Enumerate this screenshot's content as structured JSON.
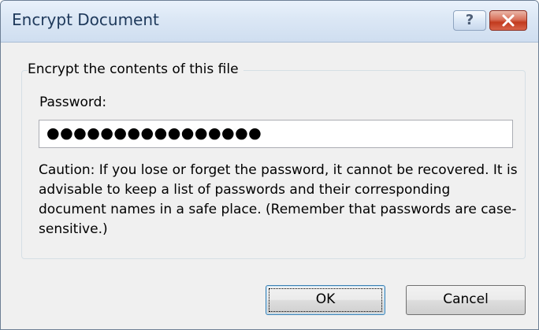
{
  "window": {
    "title": "Encrypt Document",
    "help_glyph": "?",
    "close_icon": "close-icon"
  },
  "group": {
    "legend": "Encrypt the contents of this file"
  },
  "password": {
    "label": "Password:",
    "masked_value": "●●●●●●●●●●●●●●●●"
  },
  "caution": {
    "text": "Caution: If you lose or forget the password, it cannot be recovered. It is advisable to keep a list of passwords and their corresponding document names in a safe place. (Remember that passwords are case-sensitive.)"
  },
  "buttons": {
    "ok_label": "OK",
    "cancel_label": "Cancel"
  },
  "colors": {
    "title_text": "#1e395b",
    "close_button": "#c23a1e",
    "default_button_border": "#3c7fb1"
  }
}
